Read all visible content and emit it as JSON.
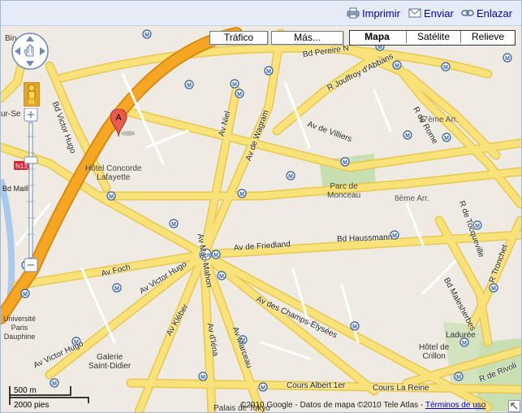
{
  "toolbar": {
    "print": {
      "label": "Imprimir",
      "icon": "printer-icon"
    },
    "send": {
      "label": "Enviar",
      "icon": "envelope-icon"
    },
    "link": {
      "label": "Enlazar",
      "icon": "chain-link-icon"
    }
  },
  "map_buttons": {
    "traffic": "Tráfico",
    "more": "Más...",
    "types": [
      "Mapa",
      "Satélite",
      "Relieve"
    ],
    "selected_type": "Mapa"
  },
  "marker": {
    "label": "A",
    "color": "#e74c3c"
  },
  "place_labels": {
    "hotel": "Hôtel Concorde\nLafayette",
    "parc": "Parc de\nMonceau",
    "arr17": "17ème Arr.",
    "arr8": "8ème Arr.",
    "galerie": "Galerie\nSaint-Didier",
    "universite": "Université\nParis\nDauphine",
    "laduree": "Ladurée",
    "crillon": "Hôtel de\nCrillon",
    "palais": "Palais de Tokyo",
    "bin": "Bin",
    "neuilly": "ur-Se",
    "n13": "N13",
    "bd_maillot": "Bd Maill"
  },
  "street_labels": [
    "Bd Pereire N",
    "Av Niel",
    "R Jouffroy d'Abbans",
    "R de Rome",
    "Bd Victor Hugo",
    "Av de Villiers",
    "Av de Wagram",
    "Av Mac-Mahon",
    "Av de Friedland",
    "Bd Haussmann",
    "R de Tocqueville",
    "Av Foch",
    "Av Victor Hugo",
    "Av Kléber",
    "Av d'Iéna",
    "Av Marceau",
    "Av des Champs-Élysées",
    "Bd Malesherbes",
    "R Tronchet",
    "R de Rivoli",
    "Cours Albert 1er",
    "Cours La Reine",
    "Av Victor Hugo"
  ],
  "scale": {
    "metric": "500 m",
    "imperial": "2000 pies"
  },
  "attribution": {
    "text": "©2010 Google - Datos de mapa ©2010 Tele Atlas - ",
    "terms": "Términos de uso"
  },
  "colors": {
    "road": "#f9e27a",
    "road_edge": "#e7c84d",
    "ring": "#f39c12",
    "park": "#c7dfb1",
    "bg": "#efebe2",
    "metro": "#2d5aa8"
  }
}
